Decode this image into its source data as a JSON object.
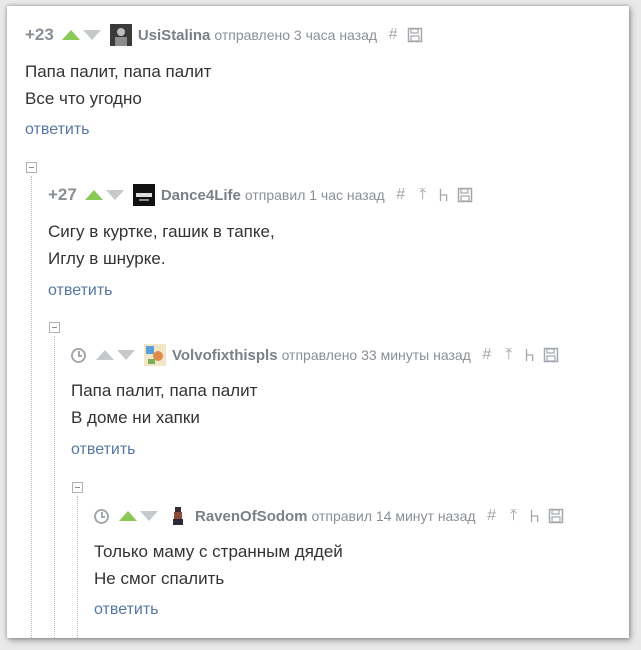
{
  "comments": [
    {
      "score": "+23",
      "username": "UsiStalina",
      "meta": "отправлено 3 часа назад",
      "lines": [
        "Папа палит, папа палит",
        "Все что угодно"
      ],
      "reply": "ответить",
      "upvoted": true,
      "avatar": "dark-portrait",
      "tools": [
        "hash-icon",
        "save-icon"
      ]
    },
    {
      "score": "+27",
      "username": "Dance4Life",
      "meta": "отправил 1 час назад",
      "lines": [
        "Сигу в куртке, гашик в тапке,",
        "Иглу в шнурке."
      ],
      "reply": "ответить",
      "upvoted": true,
      "avatar": "black-square",
      "tools": [
        "hash-icon",
        "to-parent-icon",
        "branch-icon",
        "save-icon"
      ]
    },
    {
      "score": "",
      "username": "Volvofixthispls",
      "meta": "отправлено 33 минуты назад",
      "lines": [
        "Папа палит, папа палит",
        "В доме ни хапки"
      ],
      "reply": "ответить",
      "upvoted": false,
      "avatar": "colorful-picture",
      "tools": [
        "hash-icon",
        "to-parent-icon",
        "branch-icon",
        "save-icon"
      ]
    },
    {
      "score": "",
      "username": "RavenOfSodom",
      "meta": "отправил 14 минут назад",
      "lines": [
        "Только маму с странным дядей",
        "Не смог спалить"
      ],
      "reply": "ответить",
      "upvoted": true,
      "avatar": "pixel-figure",
      "tools": [
        "hash-icon",
        "to-parent-icon",
        "branch-icon",
        "save-icon"
      ]
    }
  ],
  "colors": {
    "upvote_active": "#8ac858",
    "arrow_inactive": "#c6c9cc",
    "reply_link": "#5577a3",
    "text": "#333333",
    "meta": "#8a8f96"
  }
}
